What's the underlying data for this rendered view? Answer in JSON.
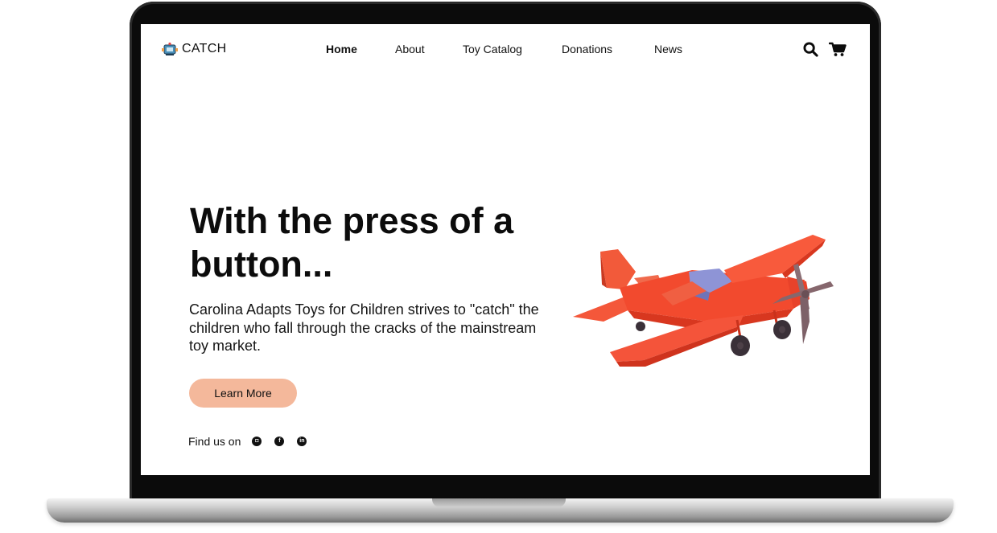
{
  "brand": {
    "name": "CATCH",
    "logo_icon": "robot-toy-icon"
  },
  "nav": {
    "items": [
      {
        "label": "Home",
        "active": true
      },
      {
        "label": "About",
        "active": false
      },
      {
        "label": "Toy Catalog",
        "active": false
      },
      {
        "label": "Donations",
        "active": false
      },
      {
        "label": "News",
        "active": false
      }
    ],
    "icons": [
      "search-icon",
      "cart-icon"
    ]
  },
  "hero": {
    "title": "With the press of a button...",
    "text": "Carolina Adapts Toys for Children strives to \"catch\" the children who fall through the cracks of the mainstream toy market.",
    "cta_label": "Learn More",
    "image": "toy-airplane-image"
  },
  "social": {
    "label": "Find us on",
    "icons": [
      "instagram-icon",
      "facebook-icon",
      "linkedin-icon"
    ]
  },
  "colors": {
    "cta": "#f4b89b",
    "text": "#111111",
    "plane": "#f24a2e",
    "bezel": "#0b0b0b"
  }
}
